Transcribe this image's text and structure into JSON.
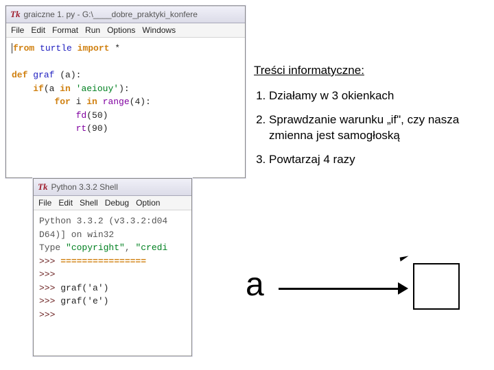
{
  "editor": {
    "title": "graiczne 1. py - G:\\____dobre_praktyki_konfere",
    "menu": {
      "file": "File",
      "edit": "Edit",
      "format": "Format",
      "run": "Run",
      "options": "Options",
      "windows": "Windows"
    },
    "code": {
      "l1_from": "from",
      "l1_module": "turtle",
      "l1_import": "import",
      "l1_star": "*",
      "l2_blank": " ",
      "l3_def": "def",
      "l3_name": "graf",
      "l3_params": "(a):",
      "l4_pad": "    ",
      "l4_if": "if",
      "l4_open": "(a ",
      "l4_in": "in",
      "l4_str": " 'aeiouy'",
      "l4_colon": "):",
      "l5_pad": "        ",
      "l5_for": "for",
      "l5_i": " i ",
      "l5_in": "in",
      "l5_range": " range",
      "l5_args": "(4):",
      "l6_pad": "            ",
      "l6_call": "fd",
      "l6_args": "(50)",
      "l7_pad": "            ",
      "l7_call": "rt",
      "l7_args": "(90)"
    }
  },
  "shell": {
    "title": "Python 3.3.2 Shell",
    "menu": {
      "file": "File",
      "edit": "Edit",
      "shell": "Shell",
      "debug": "Debug",
      "options": "Option"
    },
    "out": {
      "l1": "Python 3.3.2 (v3.3.2:d04",
      "l2": "D64)] on win32",
      "l3a": "Type ",
      "l3b": "\"copyright\"",
      "l3c": ", ",
      "l3d": "\"credi",
      "p": ">>> ",
      "eq": "================",
      "g1": "graf('a')",
      "g2": "graf('e')"
    }
  },
  "notes": {
    "title": "Treści informatyczne:",
    "items": [
      "Działamy w 3 okienkach",
      "Sprawdzanie warunku „if\", czy nasza zmienna jest samogłoską",
      "Powtarzaj 4 razy"
    ]
  },
  "diagram": {
    "a": "a"
  }
}
